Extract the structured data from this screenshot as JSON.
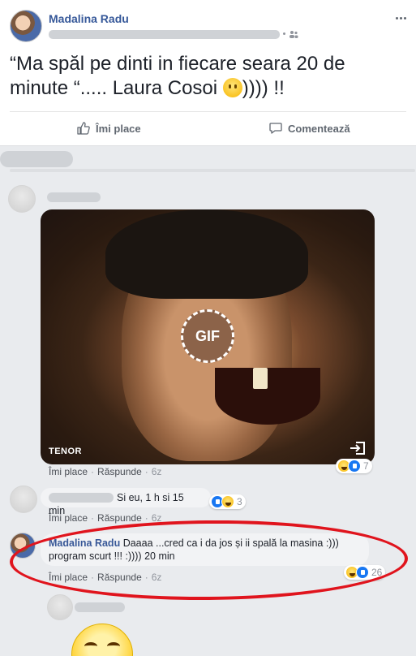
{
  "post": {
    "author": "Madalina Radu",
    "text": "“Ma spăl pe dinti in fiecare seara 20 de minute “..... Laura Cosoi ",
    "text_end": ")))) !!",
    "actions": {
      "like": "Îmi place",
      "comment": "Comentează"
    }
  },
  "comments": [
    {
      "gif": {
        "provider": "TENOR",
        "badge": "GIF"
      },
      "actions": {
        "like": "Îmi place",
        "reply": "Răspunde",
        "time": "6z"
      },
      "reactions": {
        "count": "7",
        "icons": [
          "haha-icon",
          "like-icon"
        ]
      }
    },
    {
      "text": "Si eu, 1 h si 15 min",
      "actions": {
        "like": "Îmi place",
        "reply": "Răspunde",
        "time": "6z"
      },
      "reactions": {
        "count": "3",
        "icons": [
          "like-icon",
          "haha-icon"
        ]
      }
    },
    {
      "author": "Madalina Radu",
      "text": "Daaaa ...cred ca i da jos și ii spală la masina :))) program scurt !!! :)))) 20 min",
      "actions": {
        "like": "Îmi place",
        "reply": "Răspunde",
        "time": "6z"
      },
      "reactions": {
        "count": "26",
        "icons": [
          "haha-icon",
          "like-icon"
        ]
      }
    }
  ],
  "colors": {
    "link": "#365899",
    "highlight": "#e0141d",
    "muted": "#90949c"
  }
}
